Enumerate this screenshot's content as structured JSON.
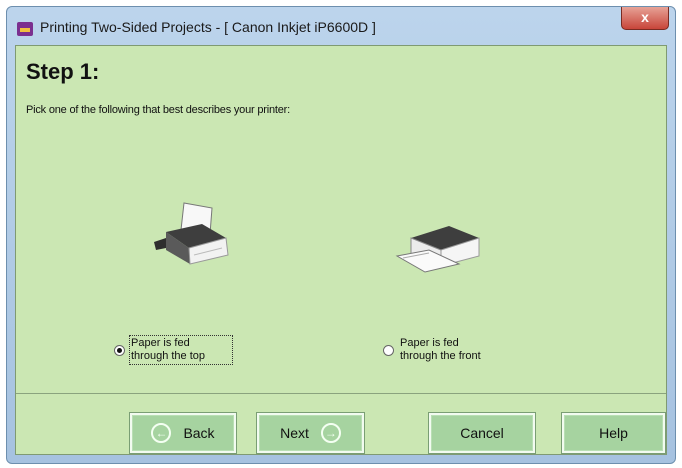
{
  "window": {
    "title": "Printing Two-Sided Projects - [ Canon Inkjet iP6600D ]",
    "close_glyph": "x"
  },
  "step": {
    "title": "Step 1:",
    "instruction": "Pick one of the following that best describes your printer:"
  },
  "options": [
    {
      "icon": "top-feed-printer-icon",
      "line1": "Paper is fed",
      "line2": "through the top",
      "selected": true
    },
    {
      "icon": "front-feed-printer-icon",
      "line1": "Paper is fed",
      "line2": "through the front",
      "selected": false
    }
  ],
  "buttons": {
    "back": "Back",
    "next": "Next",
    "cancel": "Cancel",
    "help": "Help"
  },
  "icons": {
    "back_arrow": "←",
    "next_arrow": "→"
  },
  "colors": {
    "content_bg": "#cbe7b3",
    "button_bg": "#a6d3a0",
    "title_bar": "#bcd4ec"
  }
}
